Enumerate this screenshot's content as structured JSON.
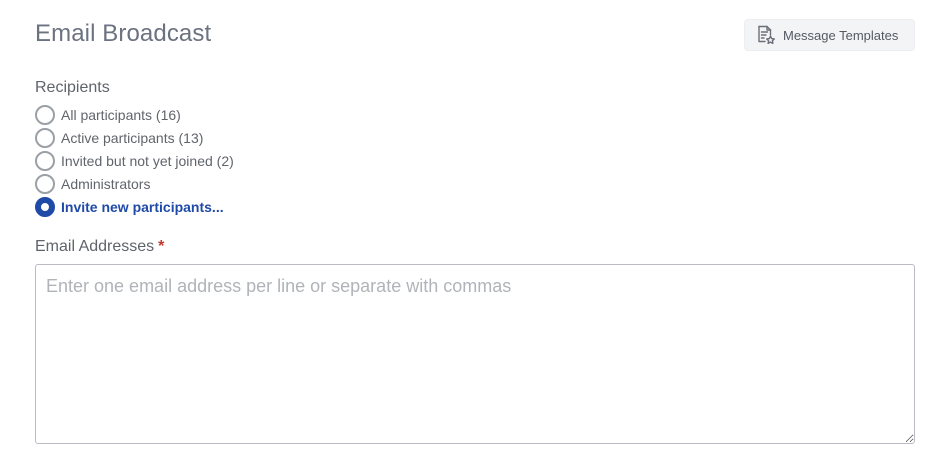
{
  "header": {
    "title": "Email Broadcast",
    "templates_button_label": "Message Templates",
    "templates_icon": "document-star-icon"
  },
  "recipients": {
    "label": "Recipients",
    "options": [
      {
        "label": "All participants (16)",
        "selected": false
      },
      {
        "label": "Active participants (13)",
        "selected": false
      },
      {
        "label": "Invited but not yet joined (2)",
        "selected": false
      },
      {
        "label": "Administrators",
        "selected": false
      },
      {
        "label": "Invite new participants...",
        "selected": true
      }
    ]
  },
  "email_addresses": {
    "label": "Email Addresses",
    "required_marker": "*",
    "value": "",
    "placeholder": "Enter one email address per line or separate with commas"
  },
  "colors": {
    "accent": "#1f4aa8",
    "required": "#c0392b",
    "button_bg": "#f3f4f6"
  }
}
